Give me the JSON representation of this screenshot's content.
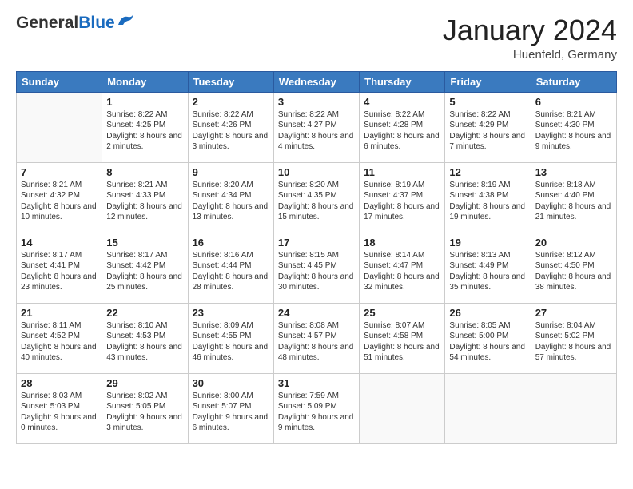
{
  "header": {
    "logo_general": "General",
    "logo_blue": "Blue",
    "month": "January 2024",
    "location": "Huenfeld, Germany"
  },
  "days_of_week": [
    "Sunday",
    "Monday",
    "Tuesday",
    "Wednesday",
    "Thursday",
    "Friday",
    "Saturday"
  ],
  "weeks": [
    [
      {
        "day": "",
        "sunrise": "",
        "sunset": "",
        "daylight": ""
      },
      {
        "day": "1",
        "sunrise": "Sunrise: 8:22 AM",
        "sunset": "Sunset: 4:25 PM",
        "daylight": "Daylight: 8 hours and 2 minutes."
      },
      {
        "day": "2",
        "sunrise": "Sunrise: 8:22 AM",
        "sunset": "Sunset: 4:26 PM",
        "daylight": "Daylight: 8 hours and 3 minutes."
      },
      {
        "day": "3",
        "sunrise": "Sunrise: 8:22 AM",
        "sunset": "Sunset: 4:27 PM",
        "daylight": "Daylight: 8 hours and 4 minutes."
      },
      {
        "day": "4",
        "sunrise": "Sunrise: 8:22 AM",
        "sunset": "Sunset: 4:28 PM",
        "daylight": "Daylight: 8 hours and 6 minutes."
      },
      {
        "day": "5",
        "sunrise": "Sunrise: 8:22 AM",
        "sunset": "Sunset: 4:29 PM",
        "daylight": "Daylight: 8 hours and 7 minutes."
      },
      {
        "day": "6",
        "sunrise": "Sunrise: 8:21 AM",
        "sunset": "Sunset: 4:30 PM",
        "daylight": "Daylight: 8 hours and 9 minutes."
      }
    ],
    [
      {
        "day": "7",
        "sunrise": "Sunrise: 8:21 AM",
        "sunset": "Sunset: 4:32 PM",
        "daylight": "Daylight: 8 hours and 10 minutes."
      },
      {
        "day": "8",
        "sunrise": "Sunrise: 8:21 AM",
        "sunset": "Sunset: 4:33 PM",
        "daylight": "Daylight: 8 hours and 12 minutes."
      },
      {
        "day": "9",
        "sunrise": "Sunrise: 8:20 AM",
        "sunset": "Sunset: 4:34 PM",
        "daylight": "Daylight: 8 hours and 13 minutes."
      },
      {
        "day": "10",
        "sunrise": "Sunrise: 8:20 AM",
        "sunset": "Sunset: 4:35 PM",
        "daylight": "Daylight: 8 hours and 15 minutes."
      },
      {
        "day": "11",
        "sunrise": "Sunrise: 8:19 AM",
        "sunset": "Sunset: 4:37 PM",
        "daylight": "Daylight: 8 hours and 17 minutes."
      },
      {
        "day": "12",
        "sunrise": "Sunrise: 8:19 AM",
        "sunset": "Sunset: 4:38 PM",
        "daylight": "Daylight: 8 hours and 19 minutes."
      },
      {
        "day": "13",
        "sunrise": "Sunrise: 8:18 AM",
        "sunset": "Sunset: 4:40 PM",
        "daylight": "Daylight: 8 hours and 21 minutes."
      }
    ],
    [
      {
        "day": "14",
        "sunrise": "Sunrise: 8:17 AM",
        "sunset": "Sunset: 4:41 PM",
        "daylight": "Daylight: 8 hours and 23 minutes."
      },
      {
        "day": "15",
        "sunrise": "Sunrise: 8:17 AM",
        "sunset": "Sunset: 4:42 PM",
        "daylight": "Daylight: 8 hours and 25 minutes."
      },
      {
        "day": "16",
        "sunrise": "Sunrise: 8:16 AM",
        "sunset": "Sunset: 4:44 PM",
        "daylight": "Daylight: 8 hours and 28 minutes."
      },
      {
        "day": "17",
        "sunrise": "Sunrise: 8:15 AM",
        "sunset": "Sunset: 4:45 PM",
        "daylight": "Daylight: 8 hours and 30 minutes."
      },
      {
        "day": "18",
        "sunrise": "Sunrise: 8:14 AM",
        "sunset": "Sunset: 4:47 PM",
        "daylight": "Daylight: 8 hours and 32 minutes."
      },
      {
        "day": "19",
        "sunrise": "Sunrise: 8:13 AM",
        "sunset": "Sunset: 4:49 PM",
        "daylight": "Daylight: 8 hours and 35 minutes."
      },
      {
        "day": "20",
        "sunrise": "Sunrise: 8:12 AM",
        "sunset": "Sunset: 4:50 PM",
        "daylight": "Daylight: 8 hours and 38 minutes."
      }
    ],
    [
      {
        "day": "21",
        "sunrise": "Sunrise: 8:11 AM",
        "sunset": "Sunset: 4:52 PM",
        "daylight": "Daylight: 8 hours and 40 minutes."
      },
      {
        "day": "22",
        "sunrise": "Sunrise: 8:10 AM",
        "sunset": "Sunset: 4:53 PM",
        "daylight": "Daylight: 8 hours and 43 minutes."
      },
      {
        "day": "23",
        "sunrise": "Sunrise: 8:09 AM",
        "sunset": "Sunset: 4:55 PM",
        "daylight": "Daylight: 8 hours and 46 minutes."
      },
      {
        "day": "24",
        "sunrise": "Sunrise: 8:08 AM",
        "sunset": "Sunset: 4:57 PM",
        "daylight": "Daylight: 8 hours and 48 minutes."
      },
      {
        "day": "25",
        "sunrise": "Sunrise: 8:07 AM",
        "sunset": "Sunset: 4:58 PM",
        "daylight": "Daylight: 8 hours and 51 minutes."
      },
      {
        "day": "26",
        "sunrise": "Sunrise: 8:05 AM",
        "sunset": "Sunset: 5:00 PM",
        "daylight": "Daylight: 8 hours and 54 minutes."
      },
      {
        "day": "27",
        "sunrise": "Sunrise: 8:04 AM",
        "sunset": "Sunset: 5:02 PM",
        "daylight": "Daylight: 8 hours and 57 minutes."
      }
    ],
    [
      {
        "day": "28",
        "sunrise": "Sunrise: 8:03 AM",
        "sunset": "Sunset: 5:03 PM",
        "daylight": "Daylight: 9 hours and 0 minutes."
      },
      {
        "day": "29",
        "sunrise": "Sunrise: 8:02 AM",
        "sunset": "Sunset: 5:05 PM",
        "daylight": "Daylight: 9 hours and 3 minutes."
      },
      {
        "day": "30",
        "sunrise": "Sunrise: 8:00 AM",
        "sunset": "Sunset: 5:07 PM",
        "daylight": "Daylight: 9 hours and 6 minutes."
      },
      {
        "day": "31",
        "sunrise": "Sunrise: 7:59 AM",
        "sunset": "Sunset: 5:09 PM",
        "daylight": "Daylight: 9 hours and 9 minutes."
      },
      {
        "day": "",
        "sunrise": "",
        "sunset": "",
        "daylight": ""
      },
      {
        "day": "",
        "sunrise": "",
        "sunset": "",
        "daylight": ""
      },
      {
        "day": "",
        "sunrise": "",
        "sunset": "",
        "daylight": ""
      }
    ]
  ]
}
